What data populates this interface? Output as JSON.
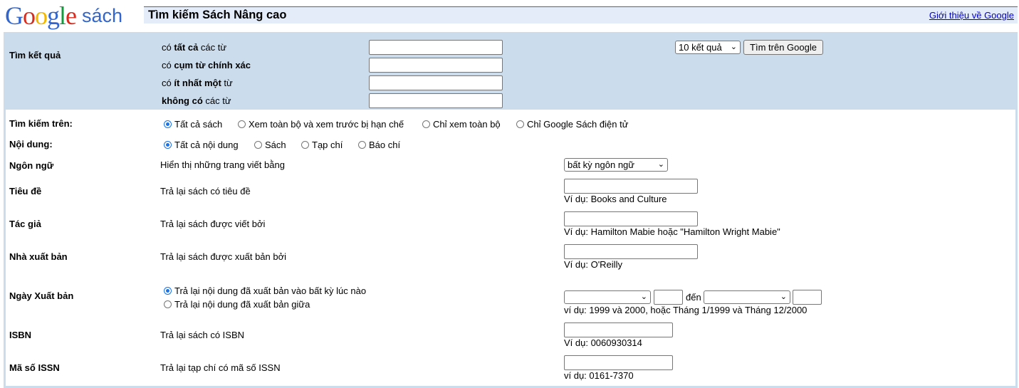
{
  "logo": {
    "word": "Google",
    "suffix": "sách"
  },
  "header": {
    "title": "Tìm kiếm Sách Nâng cao",
    "about_link": "Giới thiệu về Google"
  },
  "find_results": {
    "label": "Tìm kết quả",
    "rows": [
      {
        "pre": "có ",
        "bold": "tất cả",
        "post": " các từ",
        "value": ""
      },
      {
        "pre": "có ",
        "bold": "cụm từ chính xác",
        "post": "",
        "value": ""
      },
      {
        "pre": "có ",
        "bold": "ít nhất một",
        "post": " từ",
        "value": ""
      },
      {
        "pre": "",
        "bold": "không có",
        "post": " các từ",
        "value": ""
      }
    ],
    "results_select": "10 kết quả",
    "search_button": "Tìm trên Google"
  },
  "search_in": {
    "label": "Tìm kiếm trên:",
    "options": [
      "Tất cả sách",
      "Xem toàn bộ và xem trước bị hạn chế",
      "Chỉ xem toàn bộ",
      "Chỉ Google Sách điện tử"
    ],
    "selected": 0
  },
  "content": {
    "label": "Nội dung:",
    "options": [
      "Tất cả nội dung",
      "Sách",
      "Tạp chí",
      "Báo chí"
    ],
    "selected": 0
  },
  "language": {
    "label": "Ngôn ngữ",
    "desc": "Hiển thị những trang viết bằng",
    "select": "bất kỳ ngôn ngữ"
  },
  "title": {
    "label": "Tiêu đề",
    "desc": "Trả lại sách có tiêu đề",
    "example": "Ví dụ: Books and Culture",
    "value": ""
  },
  "author": {
    "label": "Tác giả",
    "desc": "Trả lại sách được viết bởi",
    "example": "Ví dụ: Hamilton Mabie hoặc \"Hamilton Wright Mabie\"",
    "value": ""
  },
  "publisher": {
    "label": "Nhà xuất bản",
    "desc": "Trả lại sách được xuất bản bởi",
    "example": "Ví dụ: O'Reilly",
    "value": ""
  },
  "pubdate": {
    "label": "Ngày Xuất bản",
    "options": [
      "Trả lại nội dung đã xuất bản vào bất kỳ lúc nào",
      "Trả lại nội dung đã xuất bản giữa"
    ],
    "selected": 0,
    "to": "đến",
    "example": "ví dụ: 1999 và 2000, hoặc Tháng 1/1999 và Tháng 12/2000"
  },
  "isbn": {
    "label": "ISBN",
    "desc": "Trả lại sách có ISBN",
    "example": "Ví dụ: 0060930314",
    "value": ""
  },
  "issn": {
    "label": "Mã số ISSN",
    "desc": "Trả lại tạp chí có mã số ISSN",
    "example": "ví dụ: 0161-7370",
    "value": ""
  },
  "colors": {
    "logo_blue": "#3366cc",
    "header_bg": "#e5ecf9",
    "section_bg": "#cbdced",
    "link": "#0000cc"
  }
}
